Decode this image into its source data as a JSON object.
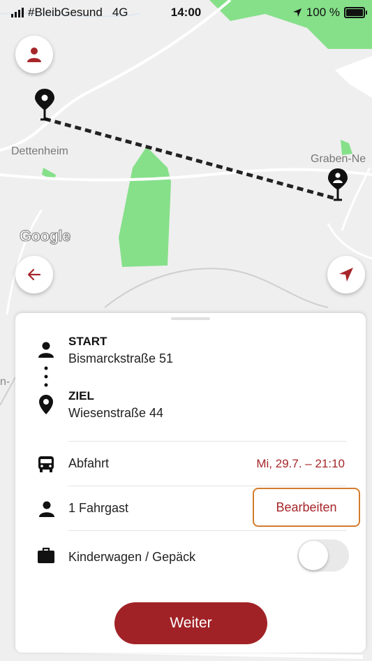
{
  "status_bar": {
    "carrier": "#BleibGesund",
    "network": "4G",
    "time": "14:00",
    "battery": "100 %",
    "battery_level": 1.0
  },
  "map": {
    "labels": {
      "town_left": "Dettenheim",
      "town_right": "Graben-Ne",
      "edge_fragment": "n-"
    },
    "attribution": "Google",
    "icons": {
      "profile": "person-icon",
      "back": "arrow-left-icon",
      "locate": "navigation-arrow-icon",
      "start_pin": "location-pin-icon",
      "end_pin": "person-pin-icon"
    }
  },
  "sheet": {
    "start": {
      "title": "START",
      "address": "Bismarckstraße 51"
    },
    "destination": {
      "title": "ZIEL",
      "address": "Wiesenstraße 44"
    },
    "departure": {
      "label": "Abfahrt",
      "value": "Mi, 29.7. – 21:10"
    },
    "passengers": {
      "label": "1 Fahrgast",
      "edit_label": "Bearbeiten"
    },
    "luggage": {
      "label": "Kinderwagen / Gepäck",
      "enabled": false
    },
    "next_label": "Weiter"
  },
  "colors": {
    "accent": "#a12226",
    "highlight_border": "#d47c2e",
    "park_green": "#86e08a",
    "route_line": "#222222"
  }
}
